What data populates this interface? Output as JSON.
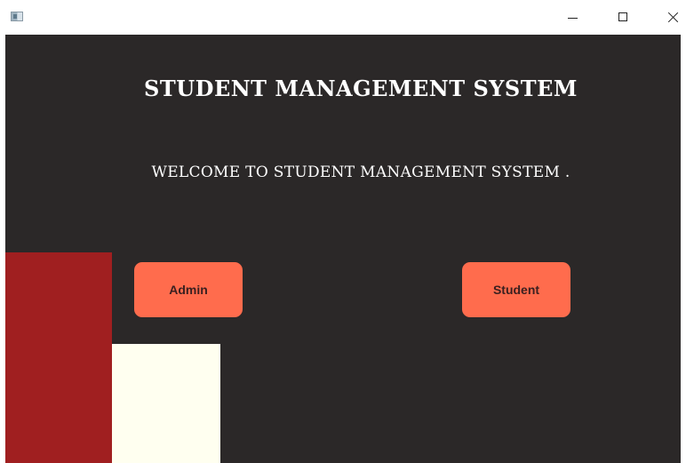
{
  "window": {
    "controls": {
      "minimize_icon": "minimize-icon",
      "maximize_icon": "maximize-icon",
      "close_icon": "close-icon"
    }
  },
  "main": {
    "title": "STUDENT MANAGEMENT SYSTEM",
    "welcome": "WELCOME TO STUDENT MANAGEMENT SYSTEM .",
    "buttons": {
      "admin_label": "Admin",
      "student_label": "Student"
    }
  },
  "colors": {
    "background": "#2b2828",
    "button": "#ff6c4d",
    "block_red": "#a01f20",
    "block_cream": "#fffff0",
    "text": "#ffffff"
  }
}
